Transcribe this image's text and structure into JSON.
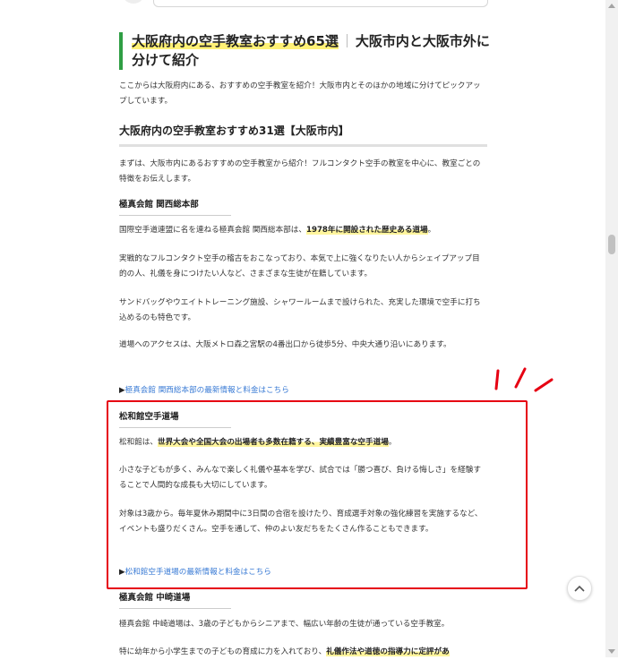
{
  "article": {
    "heading_highlight": "大阪府内の空手教室おすすめ65選",
    "heading_separator": "｜",
    "heading_rest": "大阪市内と大阪市外に分けて紹介",
    "intro": "ここからは大阪府内にある、おすすめの空手教室を紹介！大阪市内とそのほかの地域に分けてピックアップしています。",
    "section_heading": "大阪府内の空手教室おすすめ31選【大阪市内】",
    "section_intro": "まずは、大阪市内にあるおすすめの空手教室から紹介！フルコンタクト空手の教室を中心に、教室ごとの特徴をお伝えします。"
  },
  "dojos": [
    {
      "name": "極真会館 関西総本部",
      "p1_before": "国際空手道連盟に名を連ねる極真会館 関西総本部は、",
      "p1_mark": "1978年に開設された歴史ある道場",
      "p1_after": "。",
      "p2": "実戦的なフルコンタクト空手の稽古をおこなっており、本気で上に強くなりたい人からシェイプアップ目的の人、礼儀を身につけたい人など、さまざまな生徒が在籍しています。",
      "p3": "サンドバッグやウエイトトレーニング施設、シャワールームまで設けられた、充実した環境で空手に打ち込めるのも特色です。",
      "p4": "道場へのアクセスは、大阪メトロ森之宮駅の4番出口から徒歩5分、中央大通り沿いにあります。",
      "link_prefix": "▶",
      "link_text": "極真会館 関西総本部の最新情報と料金はこちら"
    },
    {
      "name": "松和館空手道場",
      "p1_before": "松和館は、",
      "p1_mark": "世界大会や全国大会の出場者も多数在籍する、実績豊富な空手道場",
      "p1_after": "。",
      "p2": "小さな子どもが多く、みんなで楽しく礼儀や基本を学び、試合では「勝つ喜び、負ける悔しさ」を経験することで人間的な成長も大切にしています。",
      "p3": "対象は3歳から。毎年夏休み期間中に3日間の合宿を設けたり、育成選手対象の強化練習を実施するなど、イベントも盛りだくさん。空手を通して、仲のよい友だちをたくさん作ることもできます。",
      "link_prefix": "▶",
      "link_text": "松和館空手道場の最新情報と料金はこちら"
    },
    {
      "name": "極真会館 中崎道場",
      "p1": "極真会館 中崎道場は、3歳の子どもからシニアまで、幅広い年齢の生徒が通っている空手教室。",
      "p2_before": "特に幼年から小学生までの子どもの育成に力を入れており、",
      "p2_mark": "礼儀作法や道徳の指導力に定評があ"
    }
  ],
  "colors": {
    "accent_green": "#2f9e44",
    "highlight_yellow": "#fff176",
    "link_blue": "#3a7bd5",
    "annotation_red": "#e60012"
  },
  "icons": {
    "back_to_top": "chevron-up-icon",
    "annotation": "attention-marks"
  }
}
